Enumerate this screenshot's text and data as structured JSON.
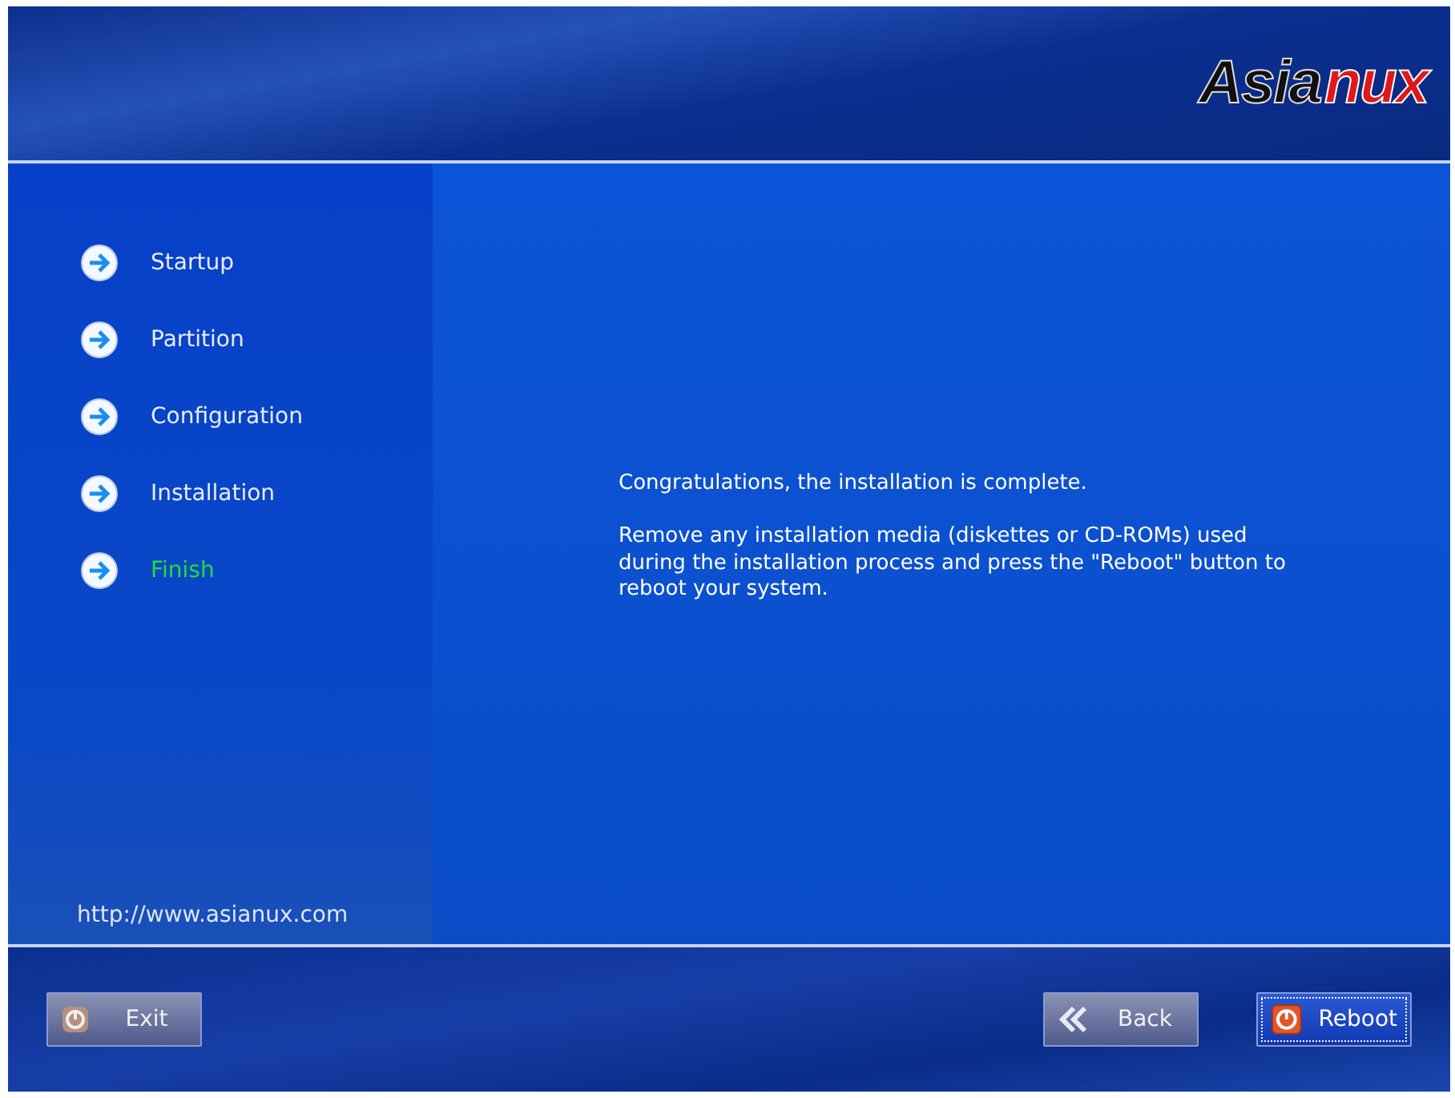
{
  "logo": {
    "part_1": "Asia",
    "part_2": "nux"
  },
  "steps": [
    {
      "label": "Startup",
      "selected": false
    },
    {
      "label": "Partition",
      "selected": false
    },
    {
      "label": "Configuration",
      "selected": false
    },
    {
      "label": "Installation",
      "selected": false
    },
    {
      "label": "Finish",
      "selected": true
    }
  ],
  "sidebar": {
    "url": "http://www.asianux.com"
  },
  "message": [
    "Congratulations, the installation is complete.",
    "Remove any installation media (diskettes or CD-ROMs) used during the installation process and press the \"Reboot\" button to reboot your system."
  ],
  "buttons": [
    {
      "kind": "exit",
      "label": "Exit",
      "disabled": true,
      "focused": false
    },
    {
      "kind": "back",
      "label": "Back",
      "disabled": true,
      "focused": false
    },
    {
      "kind": "reboot",
      "label": "Reboot",
      "disabled": false,
      "focused": true
    }
  ]
}
